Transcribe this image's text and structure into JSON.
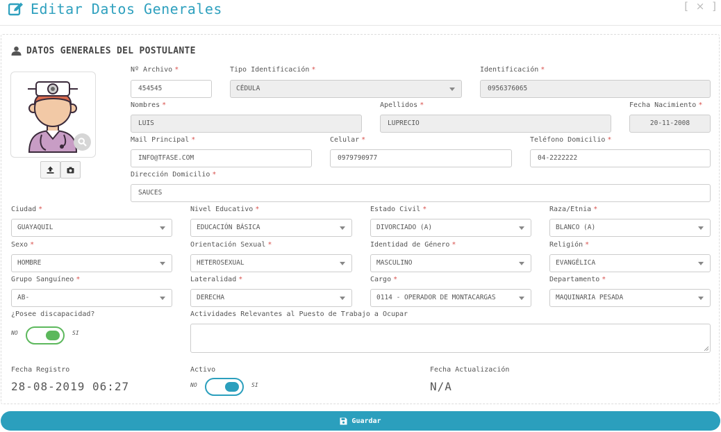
{
  "header": {
    "title": "Editar Datos Generales",
    "close_label": "[ × ]"
  },
  "section": {
    "title": "DATOS GENERALES DEL POSTULANTE"
  },
  "fields": {
    "archivo": {
      "label": "Nº Archivo",
      "value": "454545"
    },
    "tipo_identificacion": {
      "label": "Tipo Identificación",
      "value": "CÉDULA"
    },
    "identificacion": {
      "label": "Identificación",
      "value": "0956376065"
    },
    "nombres": {
      "label": "Nombres",
      "value": "LUIS"
    },
    "apellidos": {
      "label": "Apellidos",
      "value": "LUPRECIO"
    },
    "fecha_nacimiento": {
      "label": "Fecha Nacimiento",
      "value": "20-11-2008"
    },
    "mail": {
      "label": "Mail Principal",
      "value": "INFO@TFASE.COM"
    },
    "celular": {
      "label": "Celular",
      "value": "0979790977"
    },
    "telefono": {
      "label": "Teléfono Domicilio",
      "value": "04-2222222"
    },
    "direccion": {
      "label": "Dirección Domicilio",
      "value": "SAUCES"
    },
    "ciudad": {
      "label": "Ciudad",
      "value": "GUAYAQUIL"
    },
    "nivel_educativo": {
      "label": "Nivel Educativo",
      "value": "EDUCACIÓN BÁSICA"
    },
    "estado_civil": {
      "label": "Estado Civil",
      "value": "DIVORCIADO (A)"
    },
    "raza": {
      "label": "Raza/Etnia",
      "value": "BLANCO (A)"
    },
    "sexo": {
      "label": "Sexo",
      "value": "HOMBRE"
    },
    "orientacion": {
      "label": "Orientación Sexual",
      "value": "HETEROSEXUAL"
    },
    "identidad_genero": {
      "label": "Identidad de Género",
      "value": "MASCULINO"
    },
    "religion": {
      "label": "Religión",
      "value": "EVANGÉLICA"
    },
    "grupo_sanguineo": {
      "label": "Grupo Sanguíneo",
      "value": "AB-"
    },
    "lateralidad": {
      "label": "Lateralidad",
      "value": "DERECHA"
    },
    "cargo": {
      "label": "Cargo",
      "value": "0114 - OPERADOR DE MONTACARGAS"
    },
    "departamento": {
      "label": "Departamento",
      "value": "MAQUINARIA PESADA"
    },
    "discapacidad": {
      "label": "¿Posee discapacidad?",
      "no": "NO",
      "si": "SI",
      "value": "SI"
    },
    "actividades": {
      "label": "Actividades Relevantes al Puesto de Trabajo a Ocupar",
      "value": ""
    },
    "fecha_registro": {
      "label": "Fecha Registro",
      "value": "28-08-2019 06:27"
    },
    "activo": {
      "label": "Activo",
      "no": "NO",
      "si": "SI",
      "value": "SI"
    },
    "fecha_actualizacion": {
      "label": "Fecha Actualización",
      "value": "N/A"
    }
  },
  "required_mark": "*",
  "buttons": {
    "save": "Guardar"
  },
  "icons": {
    "title": "edit-icon",
    "section": "user-icon",
    "upload": "upload-icon",
    "camera": "camera-icon",
    "zoom": "search-icon",
    "save": "floppy-icon"
  },
  "colors": {
    "accent": "#2ea0be",
    "button": "#2b9fbd",
    "toggle_green": "#5cb85c",
    "required": "#d9534f"
  }
}
